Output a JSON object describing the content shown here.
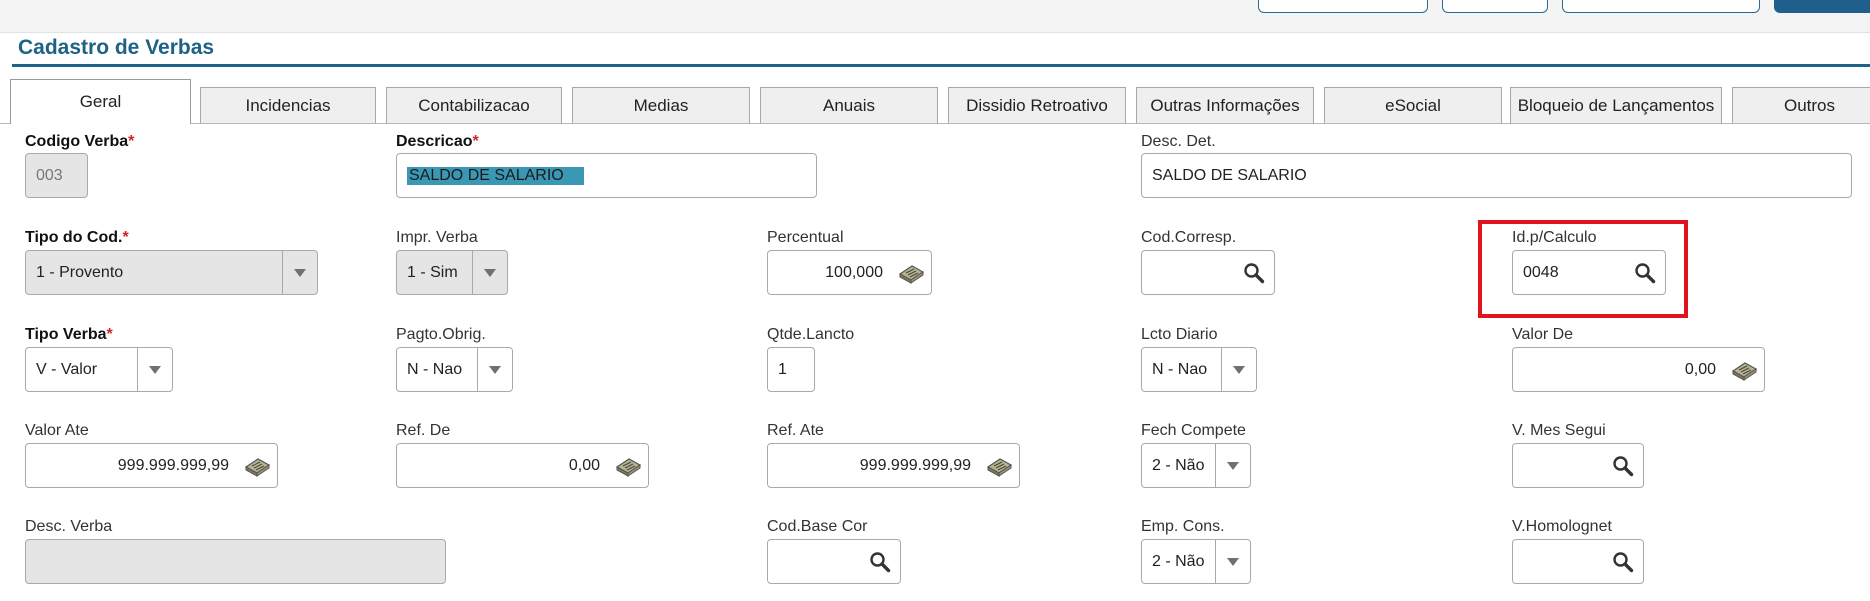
{
  "page": {
    "title": "Cadastro de Verbas"
  },
  "tabs": [
    "Geral",
    "Incidencias",
    "Contabilizacao",
    "Medias",
    "Anuais",
    "Dissidio Retroativo",
    "Outras Informações",
    "eSocial",
    "Bloqueio de Lançamentos",
    "Outros"
  ],
  "active_tab": "Geral",
  "required_mark": "*",
  "fields": {
    "codigo_verba": {
      "label": "Codigo Verba",
      "value": "003"
    },
    "descricao": {
      "label": "Descricao",
      "value": "SALDO DE SALARIO"
    },
    "desc_det": {
      "label": "Desc. Det.",
      "value": "SALDO DE SALARIO"
    },
    "tipo_cod": {
      "label": "Tipo do Cod.",
      "value": "1 - Provento"
    },
    "impr_verba": {
      "label": "Impr. Verba",
      "value": "1 - Sim"
    },
    "percentual": {
      "label": "Percentual",
      "value": "100,000"
    },
    "cod_corresp": {
      "label": "Cod.Corresp.",
      "value": ""
    },
    "id_calculo": {
      "label": "Id.p/Calculo",
      "value": "0048"
    },
    "tipo_verba": {
      "label": "Tipo Verba",
      "value": "V - Valor"
    },
    "pagto_obrig": {
      "label": "Pagto.Obrig.",
      "value": "N - Nao"
    },
    "qtde_lancto": {
      "label": "Qtde.Lancto",
      "value": "1"
    },
    "lcto_diario": {
      "label": "Lcto Diario",
      "value": "N - Nao"
    },
    "valor_de": {
      "label": "Valor De",
      "value": "0,00"
    },
    "valor_ate": {
      "label": "Valor Ate",
      "value": "999.999.999,99"
    },
    "ref_de": {
      "label": "Ref. De",
      "value": "0,00"
    },
    "ref_ate": {
      "label": "Ref. Ate",
      "value": "999.999.999,99"
    },
    "fech_compete": {
      "label": "Fech Compete",
      "value": "2 - Não"
    },
    "v_mes_segui": {
      "label": "V. Mes Segui",
      "value": ""
    },
    "desc_verba": {
      "label": "Desc. Verba",
      "value": ""
    },
    "cod_base_cor": {
      "label": "Cod.Base Cor",
      "value": ""
    },
    "emp_cons": {
      "label": "Emp. Cons.",
      "value": "2 - Não"
    },
    "v_homolognet": {
      "label": "V.Homolognet",
      "value": ""
    }
  },
  "icons": {
    "search": "magnifier-icon",
    "calc": "calculator-icon",
    "dropdown": "chevron-down-icon"
  },
  "colors": {
    "title": "#1d6386",
    "highlight": "#3b98b4",
    "required": "#d61f1f",
    "annotation": "#e0141e"
  }
}
